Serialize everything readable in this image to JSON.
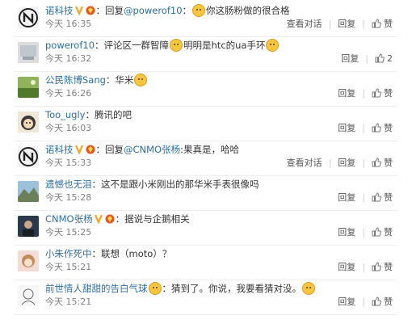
{
  "comments": [
    {
      "avatar_icon": "n-logo-avatar",
      "user": "诺科技",
      "verified": true,
      "segments": [
        {
          "type": "text",
          "text": "：回复"
        },
        {
          "type": "user",
          "text": "@powerof10"
        },
        {
          "type": "text",
          "text": "："
        },
        {
          "type": "emoji",
          "icon": "laughing-emoji"
        },
        {
          "type": "text",
          "text": "你这肠粉做的很合格"
        }
      ],
      "time": "今天 16:35",
      "view_conv": "查看对话",
      "reply": "回复",
      "like": "赞",
      "like_count": ""
    },
    {
      "avatar_icon": "grey-avatar",
      "user": "powerof10",
      "verified": false,
      "segments": [
        {
          "type": "text",
          "text": "：评论区一群智障"
        },
        {
          "type": "emoji",
          "icon": "yawn-emoji"
        },
        {
          "type": "text",
          "text": "明明是htc的ua手环"
        },
        {
          "type": "emoji",
          "icon": "cat-emoji"
        }
      ],
      "time": "今天 16:32",
      "view_conv": "",
      "reply": "回复",
      "like": "",
      "like_count": "2"
    },
    {
      "avatar_icon": "landscape-avatar",
      "user": "公民陈博Sang",
      "verified": false,
      "segments": [
        {
          "type": "text",
          "text": "：华米"
        },
        {
          "type": "emoji",
          "icon": "smile-emoji"
        }
      ],
      "time": "今天 16:26",
      "view_conv": "",
      "reply": "回复",
      "like": "赞",
      "like_count": ""
    },
    {
      "avatar_icon": "cartoon-avatar",
      "user": "Too_ugly",
      "verified": false,
      "segments": [
        {
          "type": "text",
          "text": "：腾讯的吧"
        }
      ],
      "time": "今天 16:03",
      "view_conv": "",
      "reply": "回复",
      "like": "赞",
      "like_count": ""
    },
    {
      "avatar_icon": "n-logo-avatar",
      "user": "诺科技",
      "verified": true,
      "segments": [
        {
          "type": "text",
          "text": "：回复"
        },
        {
          "type": "user",
          "text": "@CNMO张杨"
        },
        {
          "type": "text",
          "text": ":果真是，哈哈"
        }
      ],
      "time": "今天 15:33",
      "view_conv": "查看对话",
      "reply": "回复",
      "like": "赞",
      "like_count": ""
    },
    {
      "avatar_icon": "scenery-avatar",
      "user": "遗憾也无泪",
      "verified": false,
      "segments": [
        {
          "type": "text",
          "text": "：这不是跟小米刚出的那华米手表很像吗"
        }
      ],
      "time": "今天 15:28",
      "view_conv": "",
      "reply": "回复",
      "like": "赞",
      "like_count": ""
    },
    {
      "avatar_icon": "photo-avatar",
      "user": "CNMO张杨",
      "verified": true,
      "segments": [
        {
          "type": "text",
          "text": "：据说与企鹅相关"
        }
      ],
      "time": "今天 15:25",
      "view_conv": "",
      "reply": "回复",
      "like": "赞",
      "like_count": ""
    },
    {
      "avatar_icon": "anime-avatar",
      "user": "小朱作死中",
      "verified": false,
      "segments": [
        {
          "type": "text",
          "text": "：联想（moto）？"
        }
      ],
      "time": "今天 15:21",
      "view_conv": "",
      "reply": "回复",
      "like": "赞",
      "like_count": ""
    },
    {
      "avatar_icon": "sketch-avatar",
      "user": "前世情人甜甜的告白气球",
      "verified": false,
      "segments": [
        {
          "type": "emoji",
          "icon": "devil-emoji"
        },
        {
          "type": "text",
          "text": "：猜到了。你说，我要看猜对没。"
        },
        {
          "type": "emoji",
          "icon": "cat-emoji"
        }
      ],
      "time": "今天 15:21",
      "view_conv": "",
      "reply": "回复",
      "like": "赞",
      "like_count": ""
    }
  ]
}
